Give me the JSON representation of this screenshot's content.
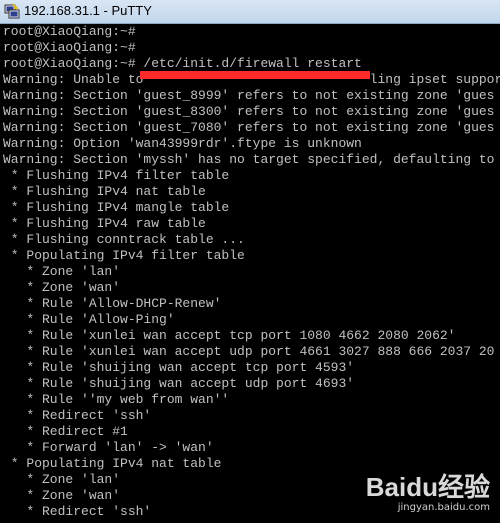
{
  "window": {
    "title": "192.168.31.1 - PuTTY"
  },
  "terminal": {
    "lines": [
      "root@XiaoQiang:~#",
      "root@XiaoQiang:~#",
      "root@XiaoQiang:~# /etc/init.d/firewall restart",
      "Warning: Unable to                             ling ipset suppor",
      "Warning: Section 'guest_8999' refers to not existing zone 'gues",
      "Warning: Section 'guest_8300' refers to not existing zone 'gues",
      "Warning: Section 'guest_7080' refers to not existing zone 'gues",
      "Warning: Option 'wan43999rdr'.ftype is unknown",
      "Warning: Section 'myssh' has no target specified, defaulting to",
      " * Flushing IPv4 filter table",
      " * Flushing IPv4 nat table",
      " * Flushing IPv4 mangle table",
      " * Flushing IPv4 raw table",
      " * Flushing conntrack table ...",
      " * Populating IPv4 filter table",
      "   * Zone 'lan'",
      "   * Zone 'wan'",
      "   * Rule 'Allow-DHCP-Renew'",
      "   * Rule 'Allow-Ping'",
      "   * Rule 'xunlei wan accept tcp port 1080 4662 2080 2062'",
      "   * Rule 'xunlei wan accept udp port 4661 3027 888 666 2037 20",
      "   * Rule 'shuijing wan accept tcp port 4593'",
      "   * Rule 'shuijing wan accept udp port 4693'",
      "   * Rule ''my web from wan''",
      "   * Redirect 'ssh'",
      "   * Redirect #1",
      "   * Forward 'lan' -> 'wan'",
      " * Populating IPv4 nat table",
      "   * Zone 'lan'",
      "   * Zone 'wan'",
      "   * Redirect 'ssh'"
    ],
    "redaction_color": "#ff2a2a",
    "text_color": "#c0c0c0",
    "background": "#000000"
  },
  "watermark": {
    "brand": "Baidu",
    "suffix": "经验",
    "url": "jingyan.baidu.com"
  },
  "icons": {
    "app_icon": "putty-icon"
  }
}
